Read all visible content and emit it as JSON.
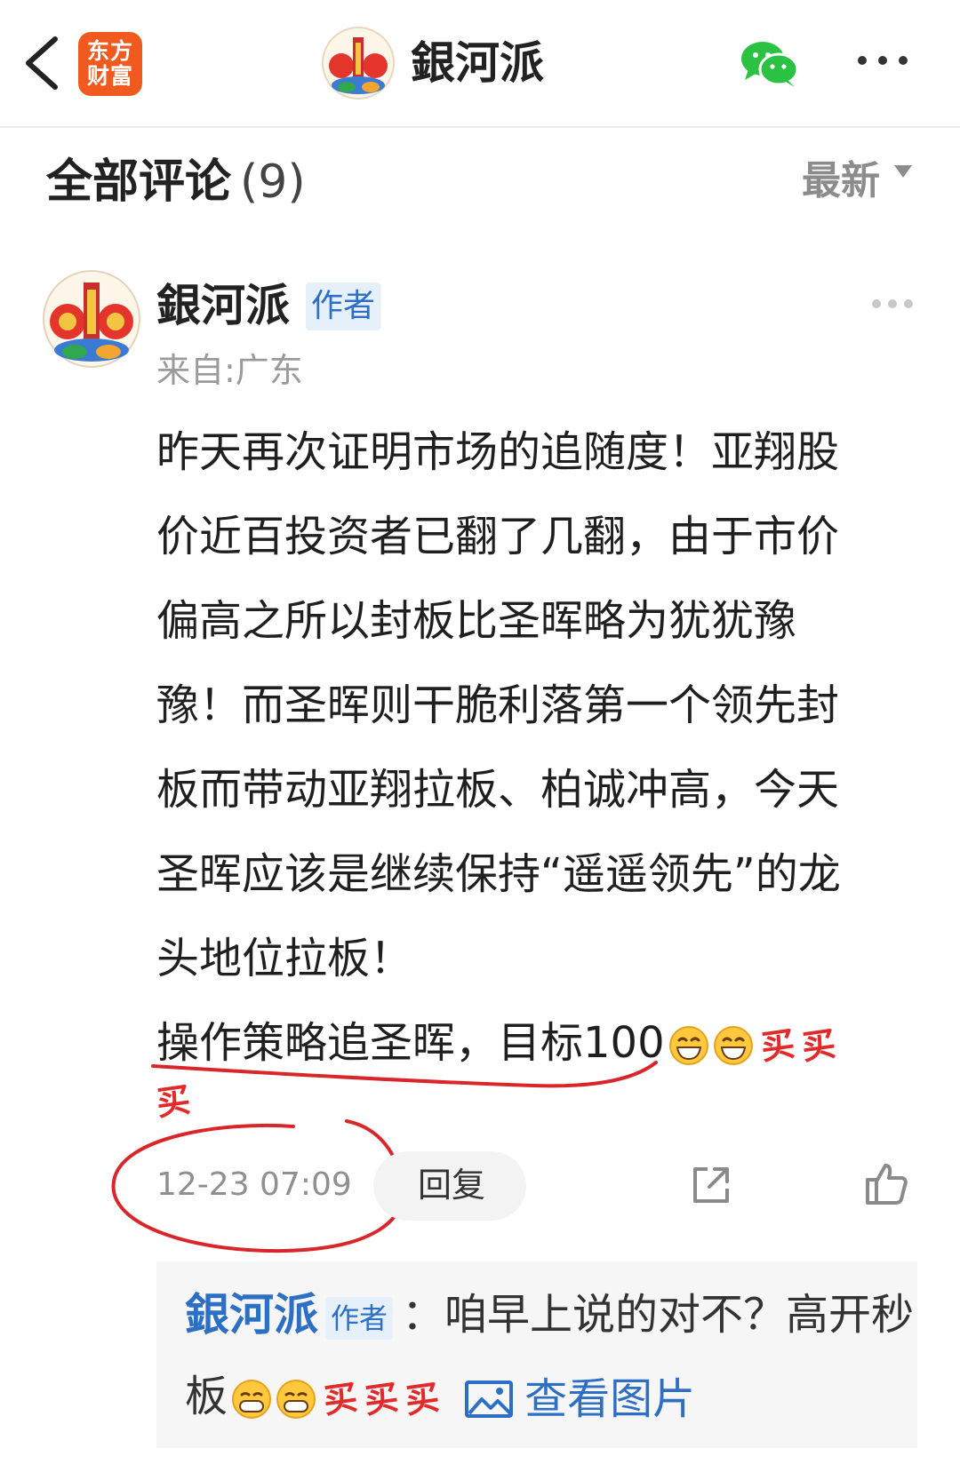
{
  "header": {
    "logo_line1": "东方",
    "logo_line2": "财富",
    "title": "銀河派"
  },
  "section": {
    "title": "全部评论",
    "count": "(9)",
    "sort_label": "最新"
  },
  "comment": {
    "author": "銀河派",
    "author_tag": "作者",
    "location": "来自:广东",
    "body_lines": [
      "昨天再次证明市场的追随度！亚翔股",
      "价近百投资者已翻了几翻，由于市价",
      "偏高之所以封板比圣晖略为犹犹豫",
      "豫！而圣晖则干脆利落第一个领先封",
      "板而带动亚翔拉板、柏诚冲高，今天",
      "圣晖应该是继续保持“遥遥领先”的龙",
      "头地位拉板！"
    ],
    "strategy": "操作策略追圣晖，目标100",
    "buy_emoji": "买",
    "time": "12-23 07:09",
    "reply_label": "回复"
  },
  "reply": {
    "author": "銀河派",
    "author_tag": "作者",
    "text_line1": "：咱早上说的对不？高开秒",
    "text_line2_prefix": "板",
    "view_image_label": "查看图片"
  },
  "colors": {
    "accent_blue": "#2d6fc4",
    "logo_orange": "#f05a1e",
    "annotation_red": "#d9262b",
    "wechat_green": "#2bc244"
  }
}
